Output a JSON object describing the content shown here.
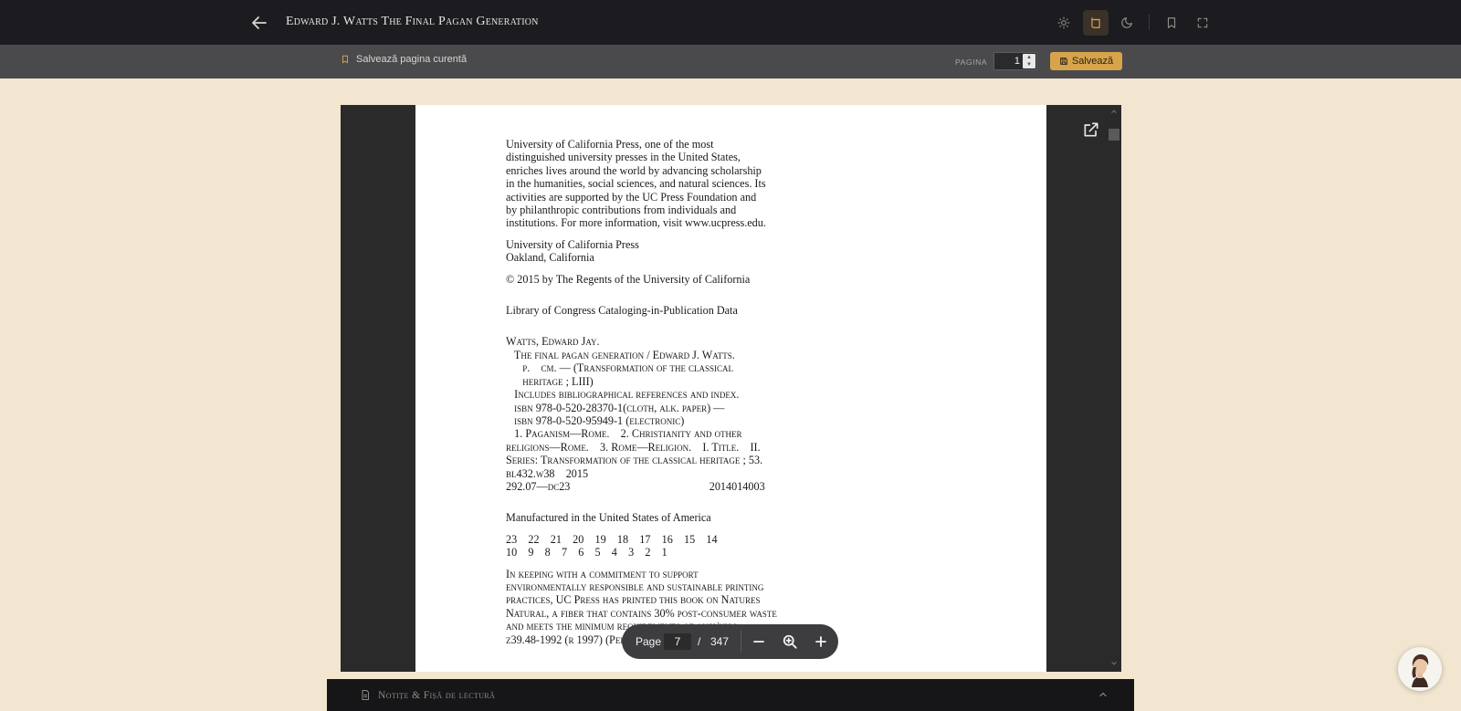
{
  "header": {
    "title": "Edward J. Watts The Final Pagan Generation",
    "back_icon": "arrow-left-icon",
    "buttons": [
      {
        "name": "light-theme-button",
        "icon": "sun-icon"
      },
      {
        "name": "sepia-theme-button",
        "icon": "book-sepia-icon",
        "active": true
      },
      {
        "name": "dark-theme-button",
        "icon": "moon-icon"
      },
      {
        "name": "bookmark-button",
        "icon": "bookmark-icon"
      },
      {
        "name": "fullscreen-button",
        "icon": "fullscreen-icon"
      }
    ]
  },
  "subbar": {
    "save_current_label": "Salvează pagina curentă",
    "page_label": "PAGINA",
    "page_value": "1",
    "save_label": "Salvează"
  },
  "document": {
    "lines_block1": [
      "University of California Press, one of the most",
      "distinguished university presses in the United States,",
      "enriches lives around the world by advancing scholarship",
      "in the humanities, social sciences, and natural sciences. Its",
      "activities are supported by the UC Press Foundation and",
      "by philanthropic contributions from individuals and",
      "institutions. For more information, visit www.ucpress.edu."
    ],
    "lines_block2": [
      "University of California Press",
      "Oakland, California"
    ],
    "copyright": "© 2015 by The Regents of the University of California",
    "cip_heading": "Library of Congress Cataloging-in-Publication Data",
    "cip_lines": [
      "Watts, Edward Jay.",
      "   The final pagan generation / Edward J. Watts.",
      "      p.    cm. — (Transformation of the classical",
      "      heritage ; LIII)",
      "   Includes bibliographical references and index.",
      "   isbn 978-0-520-28370-1(cloth, alk. paper) —",
      "   isbn 978-0-520-95949-1 (electronic)",
      "   1. Paganism—Rome.    2. Christianity and other",
      "religions—Rome.    3. Rome—Religion.    I. Title.    II.",
      "Series: Transformation of the classical heritage ; 53.",
      "bl432.w38    2015",
      "292.07—dc23                                                  2014014003"
    ],
    "manufactured": "Manufactured in the United States of America",
    "printing_lines": [
      "23    22    21    20    19    18    17    16    15    14",
      "10    9    8    7    6    5    4    3    2    1"
    ],
    "paper_lines": [
      "In keeping with a commitment to support",
      "environmentally responsible and sustainable printing",
      "practices, UC Press has printed this book on Natures",
      "Natural, a fiber that contains 30% post-consumer waste",
      "and meets the minimum requirements of ansi/niso",
      "z39.48-1992 (r 1997) (Permanence of Paper)."
    ]
  },
  "pagebar": {
    "label": "Page",
    "current": "7",
    "separator": "/",
    "total": "347"
  },
  "notes": {
    "title": "Notițe & Fișă de lectură"
  },
  "colors": {
    "topbar": "#1c1b20",
    "subbar": "#4a4a4d",
    "accent": "#d7a44b",
    "background": "#f2e6d0"
  }
}
